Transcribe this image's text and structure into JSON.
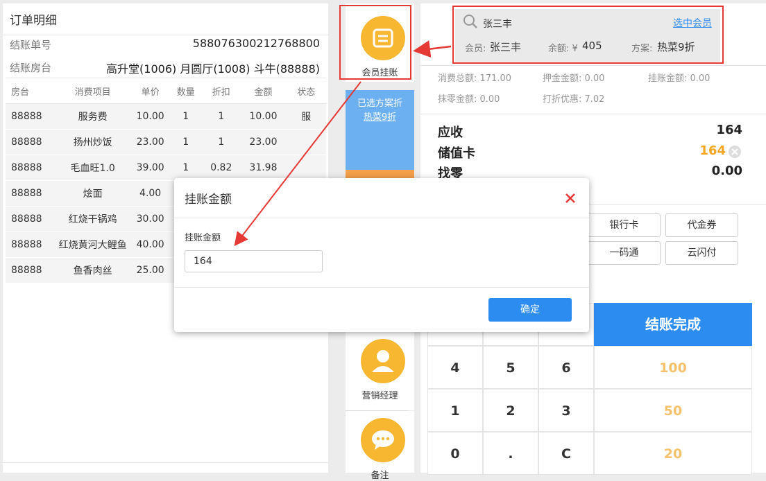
{
  "order": {
    "title": "订单明细",
    "bill_no_label": "结账单号",
    "bill_no": "588076300212768800",
    "tables_label": "结账房台",
    "tables": "高升堂(1006) 月圆厅(1008) 斗牛(88888)",
    "headers": [
      "房台",
      "消费项目",
      "单价",
      "数量",
      "折扣",
      "金额",
      "状态"
    ],
    "rows": [
      [
        "88888",
        "服务费",
        "10.00",
        "1",
        "1",
        "10.00",
        "服"
      ],
      [
        "88888",
        "扬州炒饭",
        "23.00",
        "1",
        "1",
        "23.00",
        ""
      ],
      [
        "88888",
        "毛血旺1.0",
        "39.00",
        "1",
        "0.82",
        "31.98",
        ""
      ],
      [
        "88888",
        "烩面",
        "4.00",
        "",
        "",
        "",
        ""
      ],
      [
        "88888",
        "红烧干锅鸡",
        "30.00",
        "",
        "",
        "",
        ""
      ],
      [
        "88888",
        "红烧黄河大鲤鱼",
        "40.00",
        "",
        "",
        "",
        ""
      ],
      [
        "88888",
        "鱼香肉丝",
        "25.00",
        "",
        "",
        "",
        ""
      ]
    ]
  },
  "mid": {
    "member_credit_label": "会员挂账",
    "plan_line1": "已选方案折",
    "plan_line2": "热菜9折",
    "manager_label": "营销经理",
    "note_label": "备注"
  },
  "member": {
    "search_value": "张三丰",
    "select_link": "选中会员",
    "member_label": "会员:",
    "member_name": "张三丰",
    "balance_label": "余额: ¥",
    "balance": "405",
    "plan_label": "方案:",
    "plan": "热菜9折"
  },
  "summary": {
    "total": "消费总额: 171.00",
    "deposit": "押金金额: 0.00",
    "credit": "挂账金额: 0.00",
    "rounding": "抹零金额: 0.00",
    "discount": "打折优惠: 7.02"
  },
  "payment": {
    "receivable_label": "应收",
    "receivable": "164",
    "card_label": "储值卡",
    "card_value": "164",
    "change_label": "找零",
    "change": "0.00",
    "methods": [
      "银行卡",
      "代金券",
      "一码通",
      "云闪付"
    ],
    "checkout_label": "结账完成",
    "numpad": [
      "4",
      "5",
      "6",
      "1",
      "2",
      "3",
      "0",
      ".",
      "C"
    ],
    "quick": [
      "100",
      "50",
      "20"
    ]
  },
  "modal": {
    "title": "挂账金额",
    "field_label": "挂账金额",
    "field_value": "164",
    "confirm": "确定"
  },
  "colors": {
    "accent_blue": "#2d8cf0",
    "orange": "#f5a623",
    "yellow_icon": "#f7b731",
    "annotation_red": "#e53935"
  }
}
